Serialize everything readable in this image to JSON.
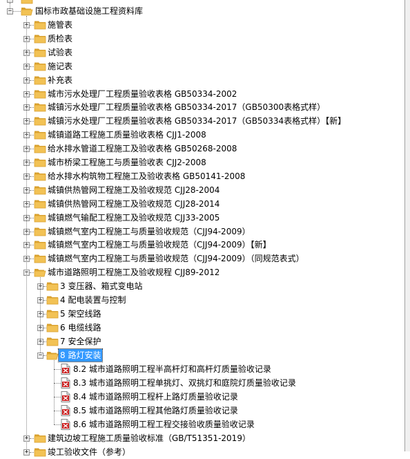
{
  "tree": {
    "root": {
      "label": "国标市政基础设施工程资料库"
    },
    "level1": [
      {
        "label": "施管表",
        "expanded": false
      },
      {
        "label": "质检表",
        "expanded": false
      },
      {
        "label": "试验表",
        "expanded": false
      },
      {
        "label": "施记表",
        "expanded": false
      },
      {
        "label": "补充表",
        "expanded": false
      },
      {
        "label": "城市污水处理厂工程质量验收表格 GB50334-2002",
        "expanded": false
      },
      {
        "label": "城镇污水处理厂工程质量验收表格 GB50334-2017（GB50300表格式样）",
        "expanded": false
      },
      {
        "label": "城镇污水处理厂工程质量验收表格 GB50334-2017（GB50334表格式样）【新】",
        "expanded": false
      },
      {
        "label": "城镇道路工程施工质量验收表格 CJJ1-2008",
        "expanded": false
      },
      {
        "label": "给水排水管道工程施工及验收表格 GB50268-2008",
        "expanded": false
      },
      {
        "label": "城市桥梁工程施工与质量验收表 CJJ2-2008",
        "expanded": false
      },
      {
        "label": "给水排水构筑物工程施工及验收表格 GB50141-2008",
        "expanded": false
      },
      {
        "label": "城镇供热管网工程施工及验收规范 CJJ28-2004",
        "expanded": false
      },
      {
        "label": "城镇供热管网工程施工及验收规范 CJJ28-2014",
        "expanded": false
      },
      {
        "label": "城镇燃气输配工程施工及验收规范 CJJ33-2005",
        "expanded": false
      },
      {
        "label": "城镇燃气室内工程施工与质量验收规范（CJJ94-2009）",
        "expanded": false
      },
      {
        "label": "城镇燃气室内工程施工与质量验收规范（CJJ94-2009）【新】",
        "expanded": false
      },
      {
        "label": "城镇燃气室内工程施工与质量验收规范（CJJ94-2009）（同规范表式）",
        "expanded": false
      },
      {
        "label": "城市道路照明工程施工及验收规程 CJJ89-2012",
        "expanded": true
      }
    ],
    "lighting_children": [
      {
        "label": "3 变压器、箱式变电站",
        "selected": false
      },
      {
        "label": "4 配电装置与控制",
        "selected": false
      },
      {
        "label": "5 架空线路",
        "selected": false
      },
      {
        "label": "6 电缆线路",
        "selected": false
      },
      {
        "label": "7 安全保护",
        "selected": false
      },
      {
        "label": "8 路灯安装",
        "selected": true
      }
    ],
    "streetlight_docs": [
      {
        "label": "8.2 城市道路照明工程半高杆灯和高杆灯质量验收记录"
      },
      {
        "label": "8.3 城市道路照明工程单挑灯、双挑灯和庭院灯质量验收记录"
      },
      {
        "label": "8.4 城市道路照明工程杆上路灯质量验收记录"
      },
      {
        "label": "8.5 城市道路照明工程其他路灯质量验收记录"
      },
      {
        "label": "8.6 城市道路照明工程工程交接验收质量验收记录"
      }
    ],
    "after": [
      {
        "label": "建筑边坡工程施工质量验收标准（GB/T51351-2019）"
      },
      {
        "label": "竣工验收文件（参考）"
      }
    ]
  },
  "colors": {
    "folder": "#f2c255",
    "folder_dark": "#d9a12f",
    "selection": "#3399ff",
    "doc_red": "#cc1f1f"
  }
}
